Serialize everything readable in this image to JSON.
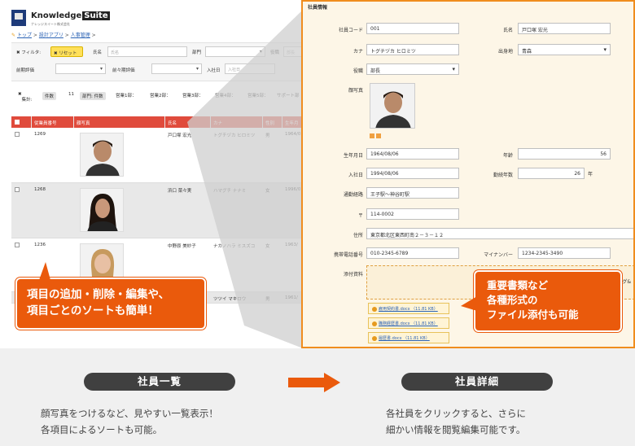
{
  "list_screen": {
    "app_name": "Knowledge",
    "app_name_box": "Suite",
    "company": "ナレッジスイート株式会社",
    "breadcrumb": {
      "icon": "pencil-icon",
      "top": "トップ",
      "sep1": ">",
      "app": "設計アプリ",
      "sep2": ">",
      "current": "人事管理",
      "sep3": ">"
    },
    "filter": {
      "label": "フィルタ:",
      "reset_label": "リセット",
      "name_label": "氏名",
      "name_placeholder": "氏名",
      "dept_label": "部門",
      "title_label": "役職",
      "title_placeholder": "部長",
      "prev_eval_label": "前期評価",
      "prev_prev_eval_label": "前々期評価",
      "join_label": "入社日",
      "join_placeholder": "入社日"
    },
    "totals": {
      "label": "集計:",
      "count_chip": "件数",
      "count": "11",
      "dept_chip": "部門: 件数",
      "d1": "営業1部：",
      "d2": "営業2部：",
      "d3": "営業3部：",
      "d4": "営業4部：",
      "d5": "営業5部：",
      "d6": "サポート部"
    },
    "columns": [
      "従業員番号",
      "顔写真",
      "氏名",
      "カナ",
      "性別",
      "生年月"
    ],
    "rows": [
      {
        "id": "1269",
        "name": "戸口塚 宏光",
        "kana": "トグチヅカ ヒロミツ",
        "gender": "男",
        "birth": "1964/0"
      },
      {
        "id": "1268",
        "name": "浜口 菜々実",
        "kana": "ハマグチ ナナミ",
        "gender": "女",
        "birth": "1996/0"
      },
      {
        "id": "1236",
        "name": "中野原 美紗子",
        "kana": "ナカノハラ ミスズコ",
        "gender": "女",
        "birth": "1963/"
      },
      {
        "id": "",
        "name": "",
        "kana": "ツツイ マキロウ",
        "gender": "男",
        "birth": "1961/"
      }
    ]
  },
  "detail_screen": {
    "section_title": "社員情報",
    "fields": {
      "emp_code_label": "社員コード",
      "emp_code": "001",
      "name_label": "氏名",
      "name": "戸口塚 宏光",
      "kana_label": "カナ",
      "kana": "トグチヅカ ヒロミツ",
      "origin_label": "出身地",
      "origin": "青森",
      "title_label": "役職",
      "title": "部長",
      "photo_label": "顔写真",
      "birth_label": "生年月日",
      "birth": "1964/08/06",
      "age_label": "年齢",
      "age": "56",
      "join_label": "入社日",
      "join": "1994/08/06",
      "years_label": "勤続年数",
      "years": "26",
      "years_unit": "年",
      "route_label": "通勤経路",
      "route": "王子駅〜神谷町駅",
      "zip_label": "〒",
      "zip": "114-0002",
      "address_label": "住所",
      "address": "東京都北区東西町南２－３－１２",
      "phone_label": "携帯電話番号",
      "phone": "010-2345-6789",
      "mynumber_label": "マイナンバー",
      "mynumber": "1234-2345-3490",
      "attach_label": "添付資料",
      "attach_hint": "グ&"
    },
    "files": [
      "雇用契約書.docx （11.81 KB）",
      "職務経歴書.docx （11.81 KB）",
      "履歴書.docx （11.81 KB）"
    ]
  },
  "callouts": {
    "left": [
      "項目の追加・削除・編集や、",
      "項目ごとのソートも簡単！"
    ],
    "right": [
      "重要書類など",
      "各種形式の",
      "ファイル添付も可能"
    ]
  },
  "bottom": {
    "left_title": "社員一覧",
    "left_desc": [
      "顔写真をつけるなど、見やすい一覧表示！",
      "各項目によるソートも可能。"
    ],
    "right_title": "社員詳細",
    "right_desc": [
      "各社員をクリックすると、さらに",
      "細かい情報を閲覧編集可能です。"
    ]
  },
  "colors": {
    "accent": "#ea5a0c",
    "header_red": "#e04b3c",
    "detail_bg": "#fdf6e7",
    "band": "#f0f0f0",
    "pill": "#404040"
  }
}
